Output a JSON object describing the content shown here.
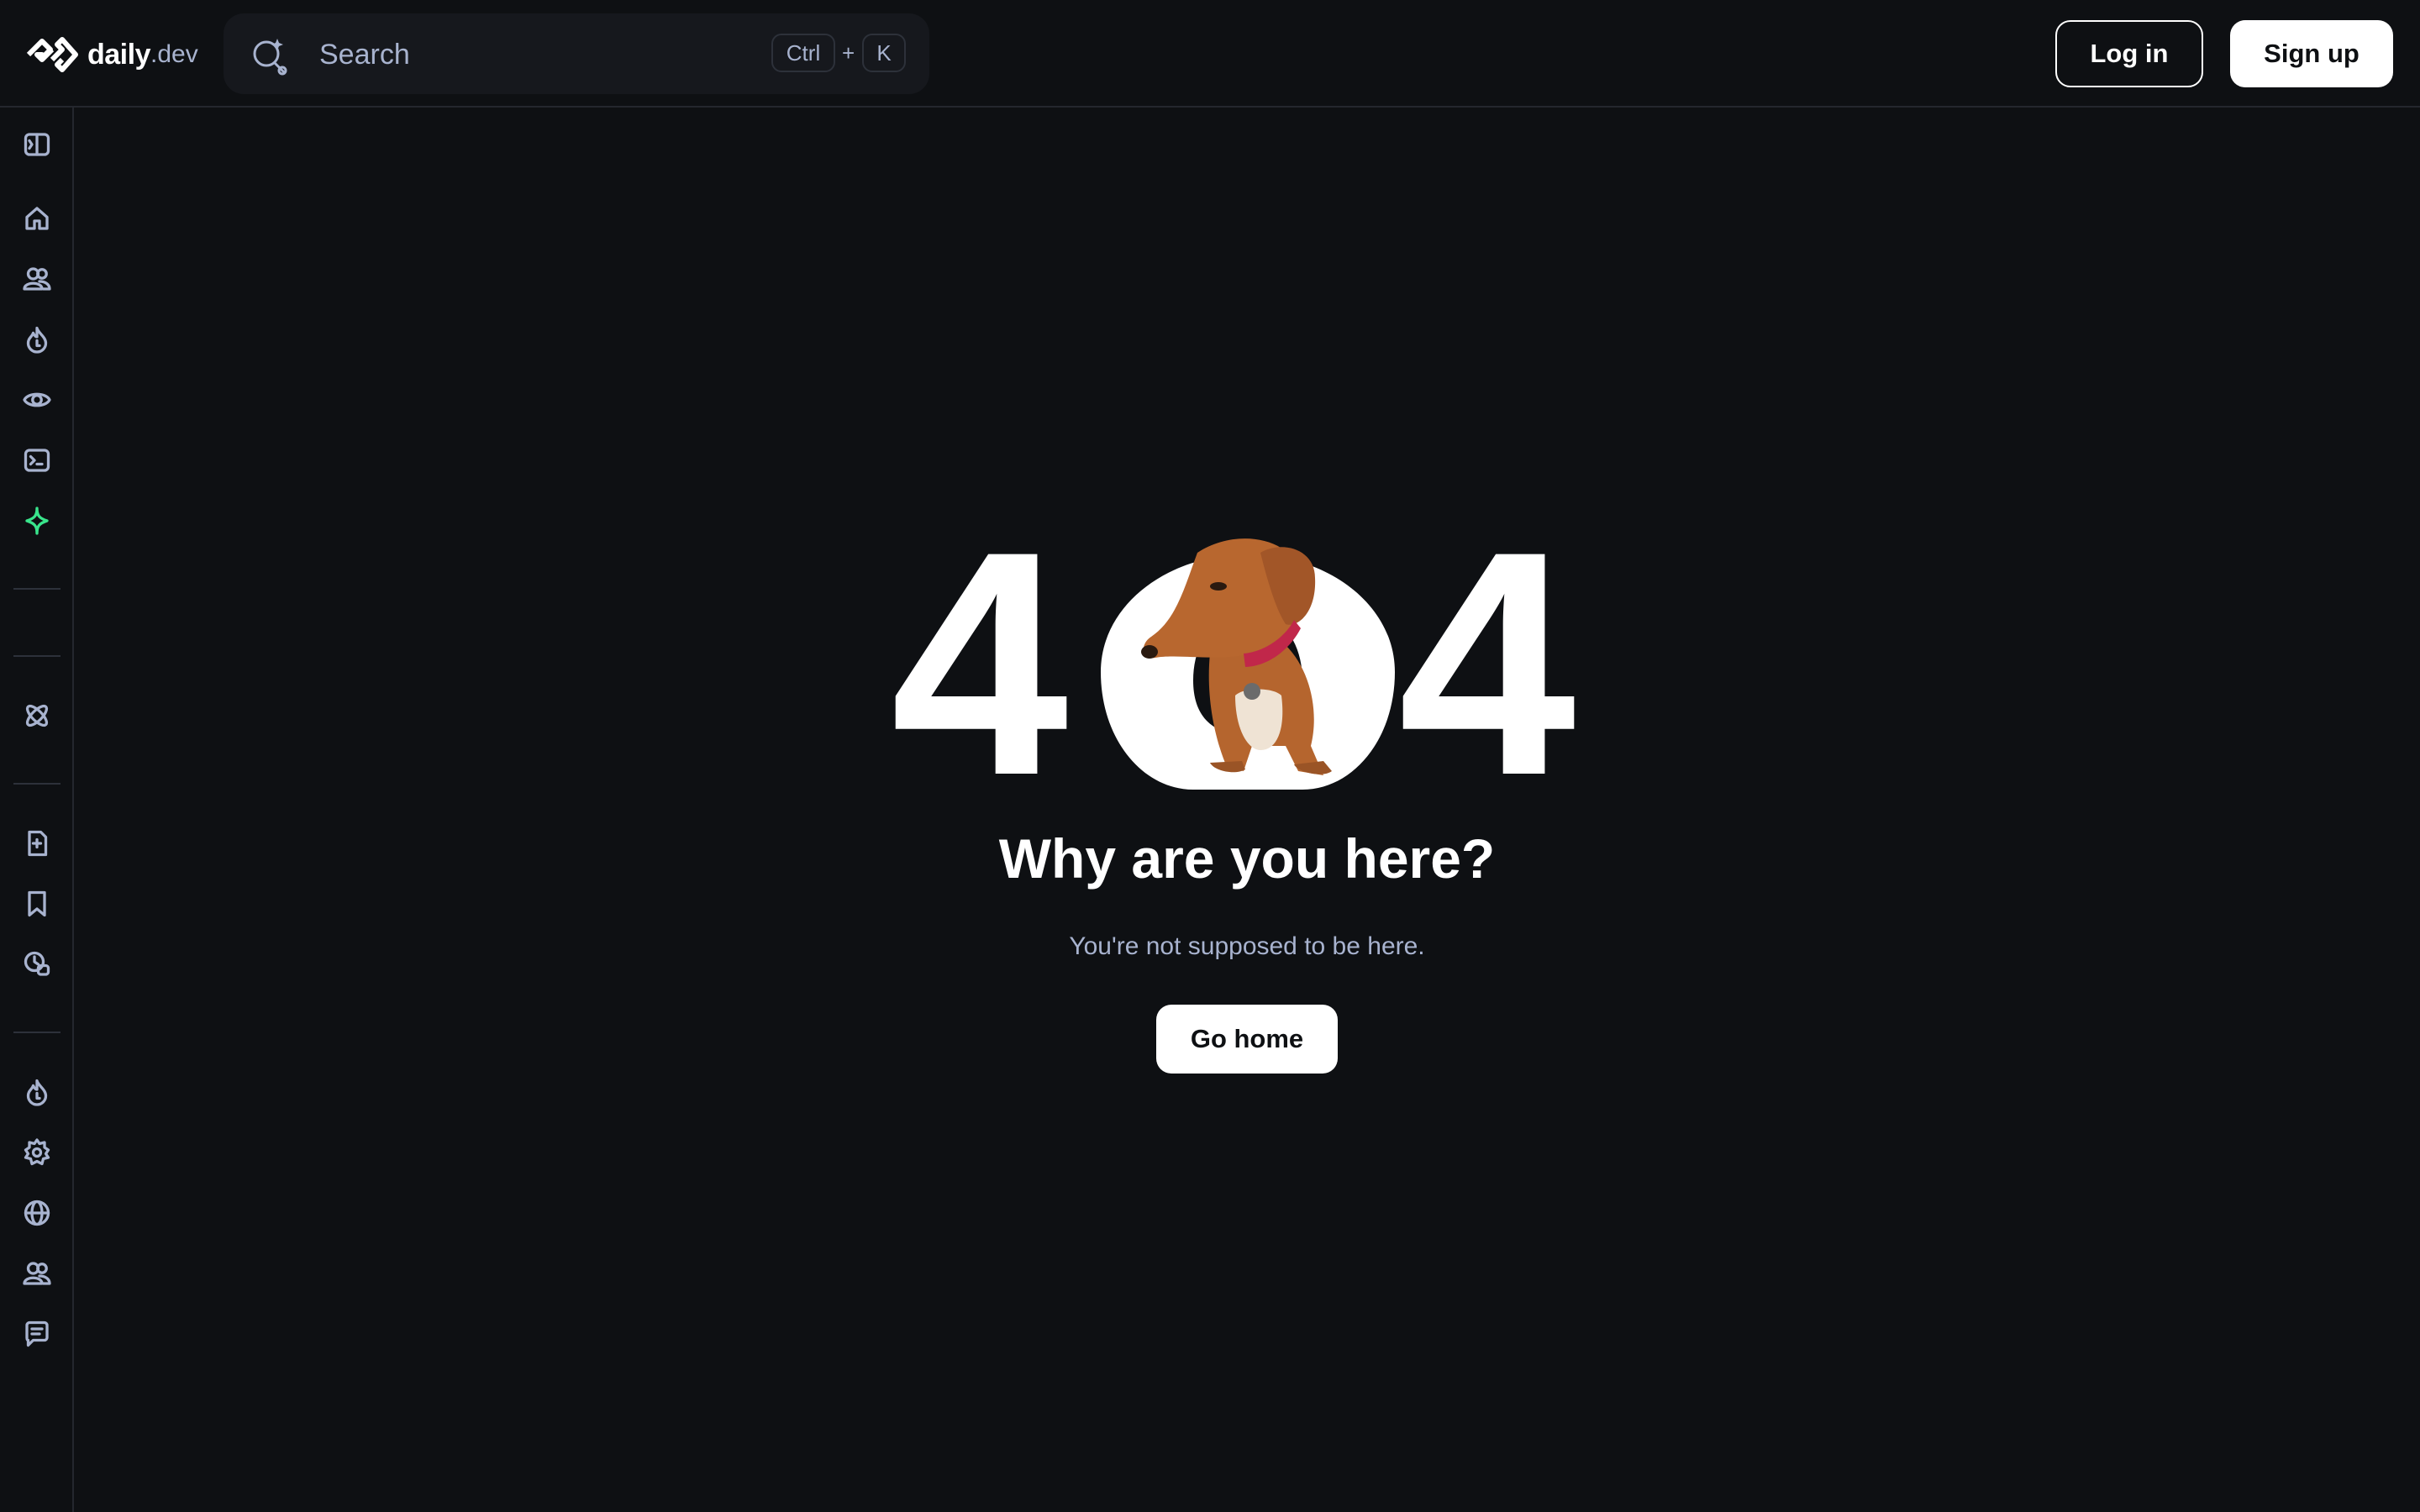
{
  "header": {
    "logo_word": "daily",
    "logo_suffix": ".dev",
    "search": {
      "placeholder": "Search",
      "shortcut_ctrl": "Ctrl",
      "shortcut_plus": "+",
      "shortcut_key": "K"
    },
    "login_label": "Log in",
    "signup_label": "Sign up"
  },
  "sidebar": {
    "items": [
      {
        "icon": "sidebar-toggle-icon"
      },
      {
        "icon": "home-icon"
      },
      {
        "icon": "squads-icon"
      },
      {
        "icon": "popular-flame-icon"
      },
      {
        "icon": "eye-icon"
      },
      {
        "icon": "terminal-icon"
      },
      {
        "icon": "sparkle-icon",
        "color": "#39e58c"
      },
      {
        "icon": "atom-icon"
      },
      {
        "icon": "new-post-icon"
      },
      {
        "icon": "bookmark-icon"
      },
      {
        "icon": "history-icon"
      },
      {
        "icon": "flame-icon"
      },
      {
        "icon": "settings-icon"
      },
      {
        "icon": "globe-icon"
      },
      {
        "icon": "users-icon"
      },
      {
        "icon": "feedback-icon"
      }
    ]
  },
  "main": {
    "code_first": "4",
    "code_last": "4",
    "title": "Why are you here?",
    "subtitle": "You're not supposed to be here.",
    "home_label": "Go home"
  },
  "colors": {
    "background": "#0e1013",
    "text_secondary": "#a8b3cf",
    "accent_green": "#39e58c",
    "border": "#24272e"
  }
}
